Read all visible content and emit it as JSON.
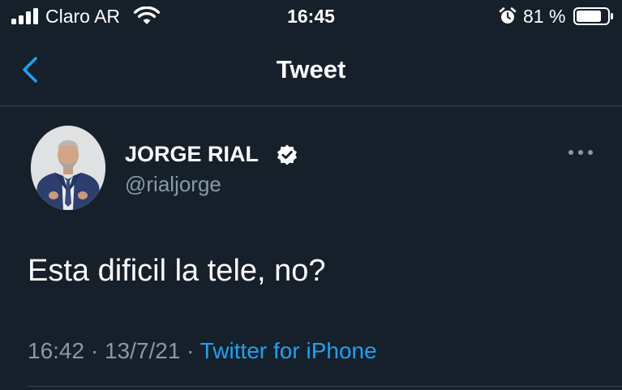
{
  "status_bar": {
    "carrier": "Claro AR",
    "time": "16:45",
    "battery_percent": "81 %",
    "battery_level": 0.81,
    "icons": [
      "signal-icon",
      "wifi-icon",
      "alarm-icon",
      "battery-icon"
    ]
  },
  "header": {
    "title": "Tweet",
    "back_icon": "chevron-left-icon"
  },
  "tweet": {
    "author_name": "JORGE RIAL",
    "handle": "@rialjorge",
    "verified": true,
    "text": "Esta dificil la tele, no?",
    "time": "16:42",
    "separator": "·",
    "date": "13/7/21",
    "source": "Twitter for iPhone",
    "more_icon": "more-options-icon"
  },
  "colors": {
    "background": "#15202b",
    "accent": "#1da1f2",
    "secondary_text": "#8899a6",
    "divider": "#38444d"
  }
}
